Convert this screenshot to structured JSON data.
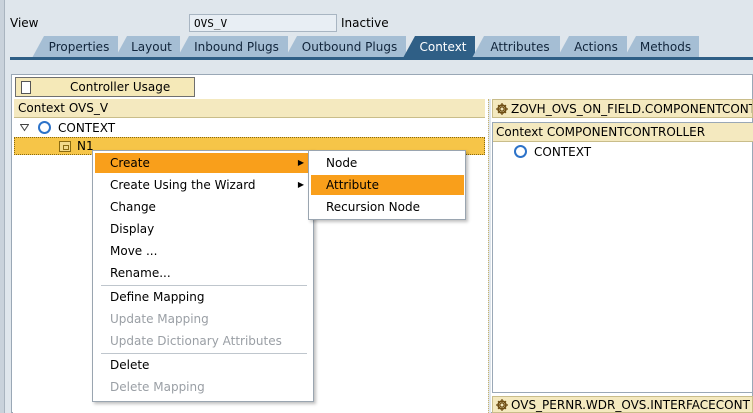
{
  "header": {
    "view_label": "View",
    "view_name": "OVS_V",
    "status": "Inactive"
  },
  "tabs": [
    {
      "label": "Properties",
      "active": false
    },
    {
      "label": "Layout",
      "active": false
    },
    {
      "label": "Inbound Plugs",
      "active": false
    },
    {
      "label": "Outbound Plugs",
      "active": false
    },
    {
      "label": "Context",
      "active": true
    },
    {
      "label": "Attributes",
      "active": false
    },
    {
      "label": "Actions",
      "active": false
    },
    {
      "label": "Methods",
      "active": false
    }
  ],
  "toolbar": {
    "controller_usage_label": "Controller Usage"
  },
  "left_panel": {
    "title": "Context OVS_V",
    "root_node": "CONTEXT",
    "child_node": "N1"
  },
  "right_panel": {
    "top_title": "ZOVH_OVS_ON_FIELD.COMPONENTCONT",
    "title": "Context COMPONENTCONTROLLER",
    "root_node": "CONTEXT",
    "bottom_title": "OVS_PERNR.WDR_OVS.INTERFACECONT"
  },
  "context_menu": {
    "items": [
      {
        "label": "Create",
        "submenu": true,
        "selected": true,
        "disabled": false
      },
      {
        "label": "Create Using the Wizard",
        "submenu": true,
        "selected": false,
        "disabled": false
      },
      {
        "label": "Change",
        "submenu": false,
        "selected": false,
        "disabled": false
      },
      {
        "label": "Display",
        "submenu": false,
        "selected": false,
        "disabled": false
      },
      {
        "label": "Move ...",
        "submenu": false,
        "selected": false,
        "disabled": false
      },
      {
        "label": "Rename...",
        "submenu": false,
        "selected": false,
        "disabled": false
      },
      {
        "label": "Define Mapping",
        "submenu": false,
        "selected": false,
        "disabled": false
      },
      {
        "label": "Update Mapping",
        "submenu": false,
        "selected": false,
        "disabled": true
      },
      {
        "label": "Update Dictionary Attributes",
        "submenu": false,
        "selected": false,
        "disabled": true
      },
      {
        "label": "Delete",
        "submenu": false,
        "selected": false,
        "disabled": false
      },
      {
        "label": "Delete Mapping",
        "submenu": false,
        "selected": false,
        "disabled": true
      }
    ]
  },
  "submenu": {
    "items": [
      {
        "label": "Node",
        "selected": false
      },
      {
        "label": "Attribute",
        "selected": true
      },
      {
        "label": "Recursion Node",
        "selected": false
      }
    ]
  },
  "colors": {
    "active_tab": "#2f5f86",
    "inactive_tab": "#a5bed4",
    "menu_highlight": "#f99f1b",
    "panel_title": "#f4e9bf",
    "selected_node": "#f6c548"
  }
}
